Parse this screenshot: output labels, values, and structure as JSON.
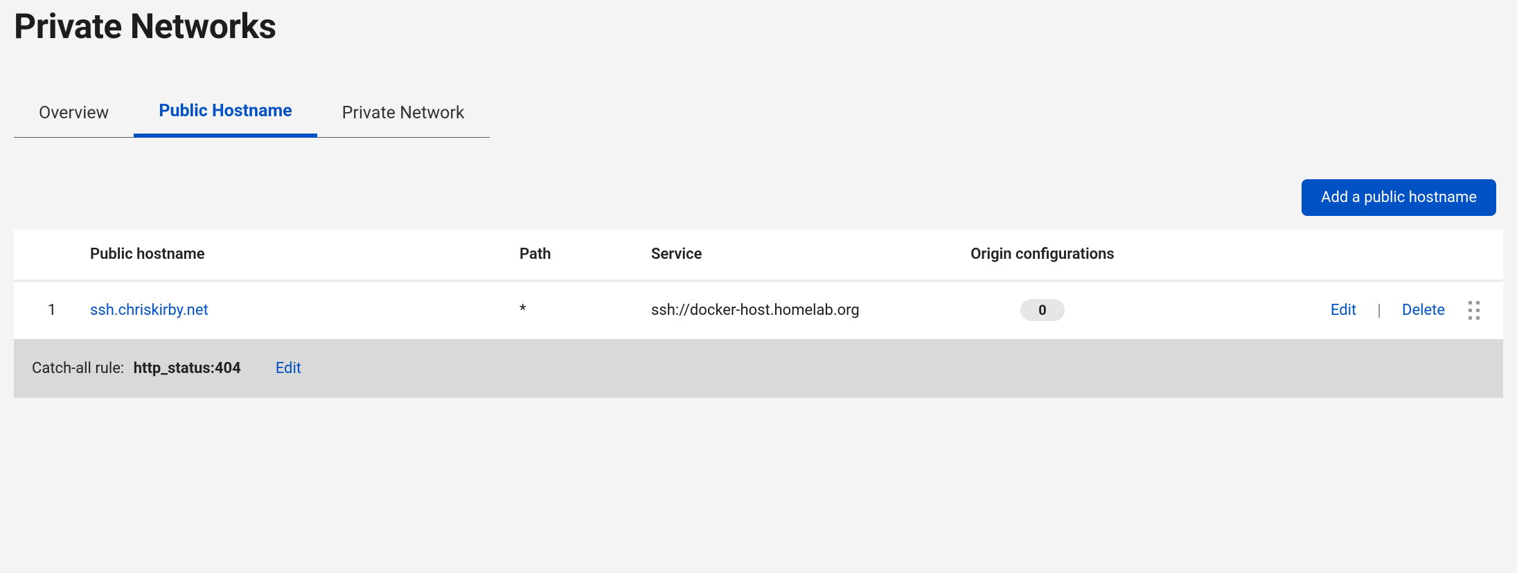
{
  "page": {
    "title": "Private Networks"
  },
  "tabs": [
    {
      "label": "Overview",
      "active": false
    },
    {
      "label": "Public Hostname",
      "active": true
    },
    {
      "label": "Private Network",
      "active": false
    }
  ],
  "actions": {
    "add_hostname_label": "Add a public hostname"
  },
  "table": {
    "headers": {
      "hostname": "Public hostname",
      "path": "Path",
      "service": "Service",
      "origin": "Origin configurations"
    },
    "rows": [
      {
        "index": "1",
        "hostname": "ssh.chriskirby.net",
        "path": "*",
        "service": "ssh://docker-host.homelab.org",
        "origin_count": "0",
        "edit_label": "Edit",
        "delete_label": "Delete"
      }
    ]
  },
  "catchall": {
    "label": "Catch-all rule:",
    "value": "http_status:404",
    "edit_label": "Edit"
  }
}
